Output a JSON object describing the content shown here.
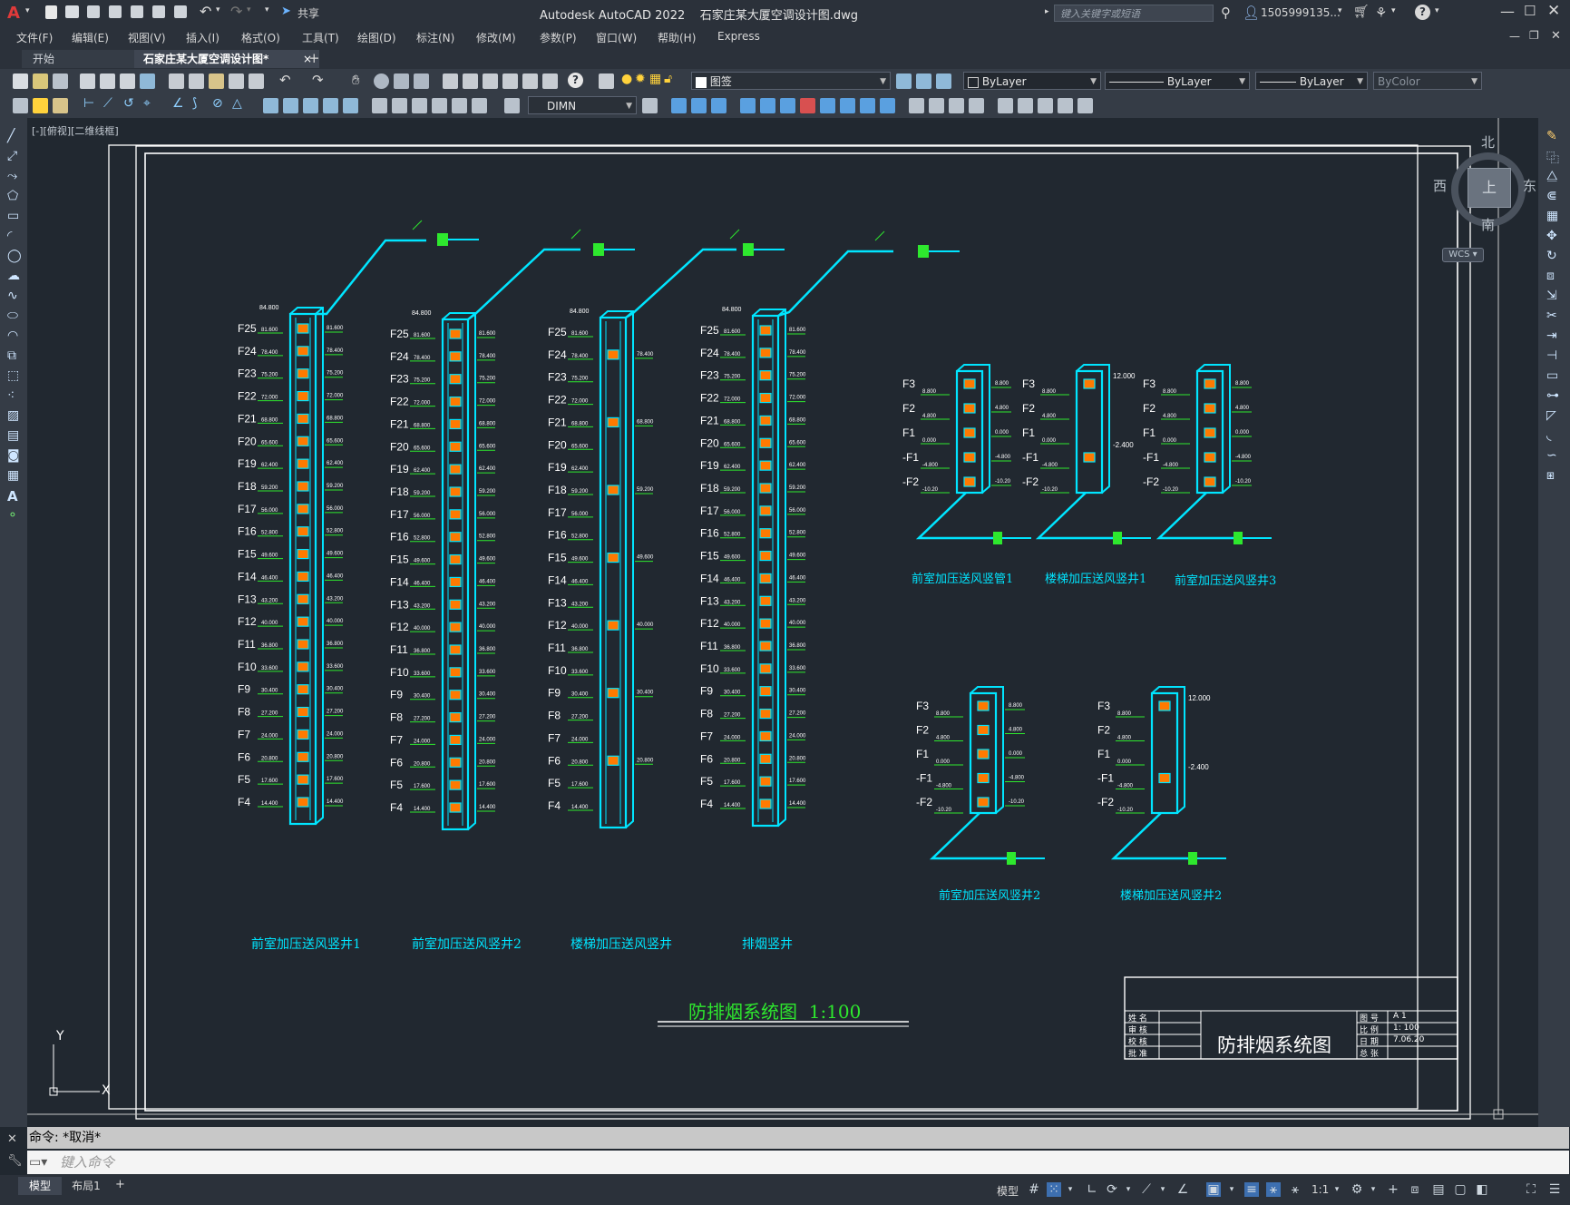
{
  "app": {
    "title": "Autodesk AutoCAD 2022    石家庄某大厦空调设计图.dwg",
    "share_label": "共享",
    "search_placeholder": "键入关键字或短语",
    "user": "1505999135...",
    "logo": "A"
  },
  "menu": [
    "文件(F)",
    "编辑(E)",
    "视图(V)",
    "插入(I)",
    "格式(O)",
    "工具(T)",
    "绘图(D)",
    "标注(N)",
    "修改(M)",
    "参数(P)",
    "窗口(W)",
    "帮助(H)",
    "Express"
  ],
  "tabs": {
    "start": "开始",
    "drawing": "石家庄某大厦空调设计图*",
    "close": "×",
    "add": "+"
  },
  "toolbar": {
    "layer": "图签",
    "color": "ByLayer",
    "linetype": "ByLayer",
    "lineweight": "ByLayer",
    "plotstyle": "ByColor",
    "dimstyle": "DIMN"
  },
  "viewport_label": "[-][俯视][二维线框]",
  "viewcube": {
    "north": "北",
    "south": "南",
    "east": "东",
    "west": "西",
    "top": "上",
    "wcs": "WCS"
  },
  "ucs": {
    "x": "X",
    "y": "Y"
  },
  "drawing": {
    "floors_main": [
      "F25",
      "F24",
      "F23",
      "F22",
      "F21",
      "F20",
      "F19",
      "F18",
      "F17",
      "F16",
      "F15",
      "F14",
      "F13",
      "F12",
      "F11",
      "F10",
      "F9",
      "F8",
      "F7",
      "F6",
      "F5",
      "F4"
    ],
    "floors_small": [
      "F3",
      "F2",
      "F1",
      "-F1",
      "-F2"
    ],
    "elevations": [
      "81.600",
      "78.400",
      "75.200",
      "72.000",
      "68.800",
      "65.600",
      "62.400",
      "59.200",
      "56.000",
      "52.800",
      "49.600",
      "46.400",
      "43.200",
      "40.000",
      "36.800",
      "33.600",
      "30.400",
      "27.200",
      "24.000",
      "20.800",
      "17.600",
      "14.400"
    ],
    "top_elev": "84.800",
    "small_elevs": [
      "8.800",
      "4.800",
      "0.000",
      "-4.800",
      "-10.20"
    ],
    "shaft_labels": [
      "前室加压送风竖井1",
      "前室加压送风竖井2",
      "楼梯加压送风竖井",
      "排烟竖井"
    ],
    "small_labels": [
      "前室加压送风竖管1",
      "楼梯加压送风竖井1",
      "前室加压送风竖井3",
      "前室加压送风竖井2",
      "楼梯加压送风竖井2"
    ],
    "small_top_b": "12.000",
    "small_mid_b": "-2.400",
    "small_mid_b2": "-2.400",
    "title": "防排烟系统图  1:100",
    "title_block": {
      "main": "防排烟系统图",
      "rows_left": [
        "姓 名",
        "审 核",
        "校 核",
        "批 准"
      ],
      "rows_right": [
        "图 号",
        "比 例",
        "日 期",
        "总 张"
      ],
      "vals_right": [
        "A 1",
        "1: 100",
        "7.06.20",
        ""
      ]
    }
  },
  "command": {
    "history": "命令: *取消*",
    "placeholder": "键入命令"
  },
  "status": {
    "model": "模型",
    "scale": "1:1"
  },
  "layout_tabs": [
    "模型",
    "布局1",
    "+"
  ],
  "colors": {
    "cyan": "#00e5ff",
    "green": "#2ee82e",
    "orange": "#ff7a00",
    "white": "#ffffff",
    "bg": "#212830"
  }
}
